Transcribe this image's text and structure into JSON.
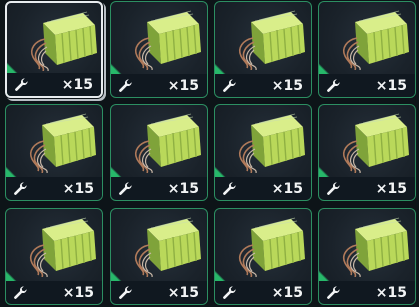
{
  "inventory": {
    "slots": [
      {
        "quantity": "×15",
        "item_icon": "battery-pack-icon",
        "badge_icon": "wrench-icon",
        "selected": true
      },
      {
        "quantity": "×15",
        "item_icon": "battery-pack-icon",
        "badge_icon": "wrench-icon",
        "selected": false
      },
      {
        "quantity": "×15",
        "item_icon": "battery-pack-icon",
        "badge_icon": "wrench-icon",
        "selected": false
      },
      {
        "quantity": "×15",
        "item_icon": "battery-pack-icon",
        "badge_icon": "wrench-icon",
        "selected": false
      },
      {
        "quantity": "×15",
        "item_icon": "battery-pack-icon",
        "badge_icon": "wrench-icon",
        "selected": false
      },
      {
        "quantity": "×15",
        "item_icon": "battery-pack-icon",
        "badge_icon": "wrench-icon",
        "selected": false
      },
      {
        "quantity": "×15",
        "item_icon": "battery-pack-icon",
        "badge_icon": "wrench-icon",
        "selected": false
      },
      {
        "quantity": "×15",
        "item_icon": "battery-pack-icon",
        "badge_icon": "wrench-icon",
        "selected": false
      },
      {
        "quantity": "×15",
        "item_icon": "battery-pack-icon",
        "badge_icon": "wrench-icon",
        "selected": false
      },
      {
        "quantity": "×15",
        "item_icon": "battery-pack-icon",
        "badge_icon": "wrench-icon",
        "selected": false
      },
      {
        "quantity": "×15",
        "item_icon": "battery-pack-icon",
        "badge_icon": "wrench-icon",
        "selected": false
      },
      {
        "quantity": "×15",
        "item_icon": "battery-pack-icon",
        "badge_icon": "wrench-icon",
        "selected": false
      }
    ]
  },
  "colors": {
    "slot_border": "#2c8f62",
    "rarity_corner": "#27b86a",
    "selected_border": "#e8ecef",
    "item_body": "#b9d85a"
  }
}
